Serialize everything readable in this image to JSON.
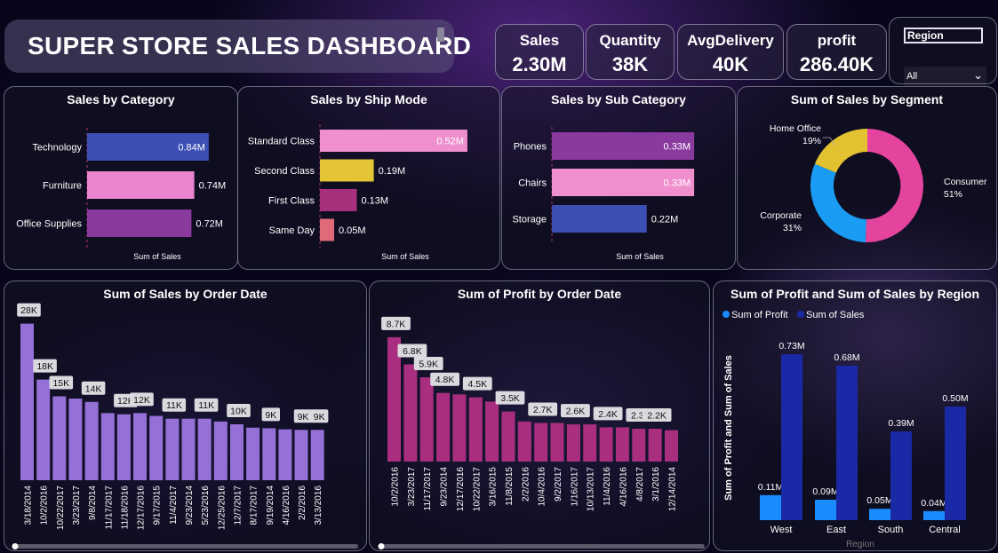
{
  "dashboard": {
    "title": "SUPER STORE  SALES DASHBOARD",
    "kpis": [
      {
        "label": "Sales",
        "value": "2.30M"
      },
      {
        "label": "Quantity",
        "value": "38K"
      },
      {
        "label": "AvgDelivery",
        "value": "40K"
      },
      {
        "label": "profit",
        "value": "286.40K"
      }
    ],
    "slicer": {
      "label": "Region",
      "selected": "All"
    }
  },
  "colors": {
    "purple": "#8a3a9e",
    "pink": "#e985cf",
    "blue": "#3d4fb4",
    "yellow": "#e5c435",
    "magenta": "#a92e80",
    "salmon": "#e06a7a",
    "lavender": "#9570d6",
    "donut_pink": "#e5449e",
    "donut_blue": "#1a9cf5",
    "donut_yellow": "#e2c230",
    "profit_blue": "#1a8cff",
    "sales_navy": "#1a2aa6"
  },
  "chart_data": [
    {
      "id": "sales-by-category",
      "type": "bar",
      "orientation": "horizontal",
      "title": "Sales by Category",
      "xlabel": "Sum of Sales",
      "categories": [
        "Technology",
        "Furniture",
        "Office Supplies"
      ],
      "values": [
        0.84,
        0.74,
        0.72
      ],
      "labels": [
        "0.84M",
        "0.74M",
        "0.72M"
      ],
      "colors": [
        "#3d4fb4",
        "#e985cf",
        "#8a3a9e"
      ]
    },
    {
      "id": "sales-by-ship-mode",
      "type": "bar",
      "orientation": "horizontal",
      "title": "Sales by Ship Mode",
      "xlabel": "Sum of Sales",
      "categories": [
        "Standard Class",
        "Second Class",
        "First Class",
        "Same Day"
      ],
      "values": [
        0.52,
        0.19,
        0.13,
        0.05
      ],
      "labels": [
        "0.52M",
        "0.19M",
        "0.13M",
        "0.05M"
      ],
      "colors": [
        "#ef8fce",
        "#e5c435",
        "#a8307c",
        "#e06a7a"
      ]
    },
    {
      "id": "sales-by-sub-category",
      "type": "bar",
      "orientation": "horizontal",
      "title": "Sales by Sub Category",
      "xlabel": "Sum of Sales",
      "categories": [
        "Phones",
        "Chairs",
        "Storage"
      ],
      "values": [
        0.33,
        0.33,
        0.22
      ],
      "labels": [
        "0.33M",
        "0.33M",
        "0.22M"
      ],
      "colors": [
        "#8a3a9e",
        "#ef8fce",
        "#3d4fb4"
      ]
    },
    {
      "id": "sales-by-segment",
      "type": "pie",
      "title": "Sum of Sales by Segment",
      "categories": [
        "Consumer",
        "Corporate",
        "Home Office"
      ],
      "values": [
        51,
        31,
        19
      ],
      "labels": [
        "51%",
        "31%",
        "19%"
      ],
      "colors": [
        "#e5449e",
        "#1a9cf5",
        "#e2c230"
      ]
    },
    {
      "id": "sales-by-order-date",
      "type": "bar",
      "title": "Sum of Sales by Order Date",
      "categories": [
        "3/18/2014",
        "10/2/2016",
        "10/22/2017",
        "3/23/2017",
        "9/8/2014",
        "11/17/2017",
        "11/18/2016",
        "12/17/2016",
        "9/17/2015",
        "11/4/2017",
        "9/23/2014",
        "5/23/2016",
        "12/25/2016",
        "12/7/2017",
        "8/17/2017",
        "9/19/2014",
        "4/16/2016",
        "2/2/2016",
        "3/13/2016"
      ],
      "values": [
        28,
        18,
        15,
        14.6,
        14,
        12,
        11.8,
        12,
        11.5,
        11,
        11,
        11,
        10.5,
        10,
        9.4,
        9.3,
        9.1,
        9,
        9
      ],
      "labels": [
        "28K",
        "18K",
        "15K",
        "",
        "14K",
        "",
        "12K",
        "12K",
        "",
        "11K",
        "",
        "11K",
        "",
        "10K",
        "",
        "9K",
        "",
        "9K",
        "9K"
      ],
      "color": "#9570d6"
    },
    {
      "id": "profit-by-order-date",
      "type": "bar",
      "title": "Sum of Profit by Order Date",
      "categories": [
        "10/2/2016",
        "3/23/2017",
        "11/17/2017",
        "9/23/2014",
        "12/17/2016",
        "10/22/2017",
        "3/16/2015",
        "11/8/2015",
        "2/2/2016",
        "10/4/2016",
        "9/2/2017",
        "1/16/2017",
        "10/13/2017",
        "11/4/2016",
        "4/16/2016",
        "4/8/2017",
        "3/1/2016",
        "12/14/2014"
      ],
      "values": [
        8.7,
        6.8,
        5.9,
        4.8,
        4.7,
        4.5,
        4.2,
        3.5,
        2.8,
        2.7,
        2.7,
        2.6,
        2.6,
        2.4,
        2.4,
        2.3,
        2.3,
        2.2
      ],
      "labels": [
        "8.7K",
        "6.8K",
        "5.9K",
        "4.8K",
        "",
        "4.5K",
        "",
        "3.5K",
        "",
        "2.7K",
        "",
        "2.6K",
        "",
        "2.4K",
        "",
        "2.3K",
        "2.2K",
        ""
      ],
      "color": "#a92e80"
    },
    {
      "id": "profit-sales-by-region",
      "type": "bar",
      "title": "Sum of Profit and Sum of Sales by Region",
      "xlabel": "Region",
      "ylabel": "Sum of Profit and Sum of Sales",
      "categories": [
        "West",
        "East",
        "South",
        "Central"
      ],
      "series": [
        {
          "name": "Sum of Profit",
          "values": [
            0.11,
            0.09,
            0.05,
            0.04
          ],
          "labels": [
            "0.11M",
            "0.09M",
            "0.05M",
            "0.04M"
          ],
          "color": "#1a8cff"
        },
        {
          "name": "Sum of Sales",
          "values": [
            0.73,
            0.68,
            0.39,
            0.5
          ],
          "labels": [
            "0.73M",
            "0.68M",
            "0.39M",
            "0.50M"
          ],
          "color": "#1a2aa6"
        }
      ],
      "legend": "top-left"
    }
  ]
}
